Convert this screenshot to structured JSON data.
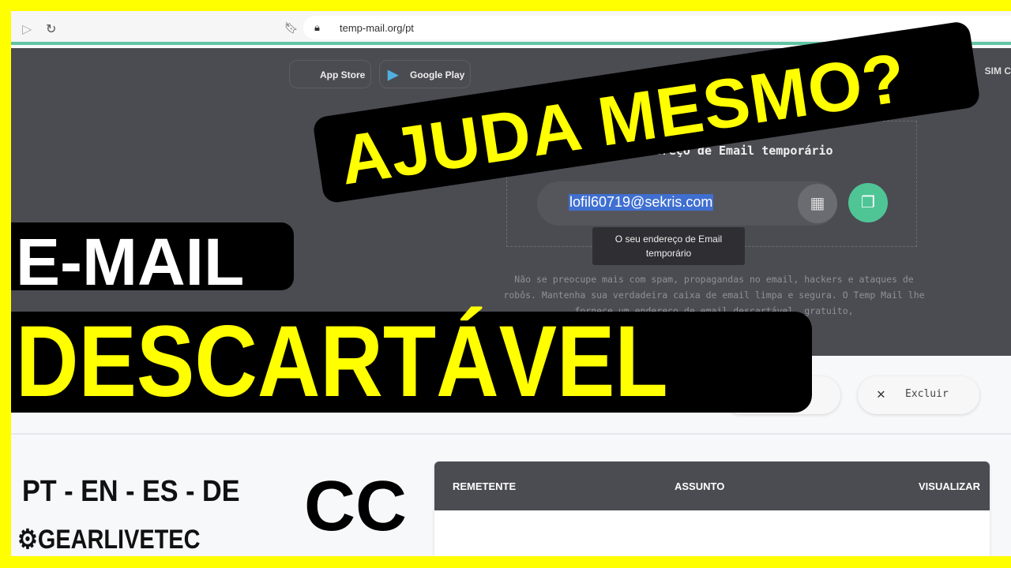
{
  "browser": {
    "url": "temp-mail.org/pt",
    "back_icon": "play-icon",
    "reload_icon": "reload-icon",
    "bookmark_icon": "bookmark-icon",
    "lock_icon": "lock-icon"
  },
  "hero": {
    "app_store": "App Store",
    "google_play": "Google Play",
    "sim": "SIM C",
    "title": "o seu endereço de Email temporário",
    "email": "lofil60719@sekris.com",
    "tooltip": "O seu endereço de Email temporário",
    "description": "Não se preocupe mais com spam, propagandas no email, hackers e ataques de robôs. Mantenha sua verdadeira caixa de email limpa e segura. O Temp Mail lhe fornece um endereço de email descartável, gratuito,"
  },
  "actions": {
    "delete": "Excluir"
  },
  "inbox": {
    "columns": [
      "REMETENTE",
      "ASSUNTO",
      "VISUALIZAR"
    ]
  },
  "overlay": {
    "ajuda": "AJUDA MESMO?",
    "email": "E-MAIL",
    "descartavel": "DESCARTÁVEL",
    "langs": "PT - EN - ES - DE",
    "cc": "CC",
    "brand": "GEARLIVETEC"
  },
  "colors": {
    "border": "#ffff00",
    "accent": "#4fc596",
    "hero_bg": "#4b4b52",
    "selection": "#3f6fd0"
  }
}
